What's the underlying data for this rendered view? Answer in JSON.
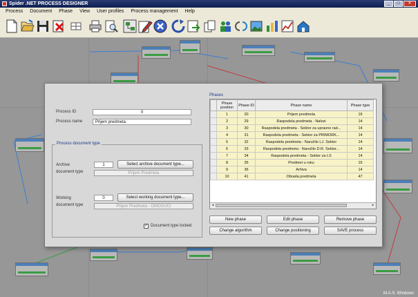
{
  "window": {
    "title": "Spider .NET PROCESS DESIGNER"
  },
  "menu": [
    "Process",
    "Document",
    "Phase",
    "View",
    "User profiles",
    "Process management",
    "Help"
  ],
  "toolbar_icons": [
    "new-icon",
    "open-icon",
    "save-icon",
    "delete-icon",
    "grid-icon",
    "print-icon",
    "print-preview-icon",
    "layout-icon",
    "edit-icon",
    "cancel-icon",
    "refresh-icon",
    "export-icon",
    "copy-icon",
    "users-icon",
    "link-icon",
    "image-icon",
    "chart-icon",
    "graph-icon",
    "home-icon"
  ],
  "status_text": "M.A.S. Windows",
  "dialog": {
    "process_id_label": "Process ID",
    "process_id_value": "0",
    "process_name_label": "Process name",
    "process_name_value": "Prijem predmeta",
    "doc_type_group_title": "Process document type",
    "archive_label": "Archive",
    "archive_label2": "document type",
    "archive_id": "1",
    "archive_button": "Select archive document type...",
    "archive_value": "Prijem Predmeta",
    "working_label": "Working",
    "working_label2": "document type",
    "working_id": "0",
    "working_button": "Select working document type...",
    "working_value": "Prijem Predmeta - OMOGUĆI",
    "locked_checkbox_label": "Document type locked",
    "locked_checked": true,
    "phases_title": "Phases",
    "phases_headers": [
      "Phase position",
      "Phase ID",
      "Phase name",
      "Phase type"
    ],
    "phases_rows": [
      [
        "1",
        "20",
        "Prijem predmeta",
        "16"
      ],
      [
        "2",
        "29",
        "Raspodela predmeta - Nalozi",
        "14"
      ],
      [
        "3",
        "30",
        "Raspodela predmeta - Sektor za upravne rad...",
        "14"
      ],
      [
        "4",
        "31",
        "Raspodela predmeta - Sektor za PRIMORK...",
        "14"
      ],
      [
        "5",
        "32",
        "Raspodela predmeta - Naručilo LJ. Sektor",
        "14"
      ],
      [
        "6",
        "33",
        "Raspodela predmeta - Naručilo D.R. Sektor...",
        "14"
      ],
      [
        "7",
        "34",
        "Raspodela predmeta - Sektor za LS",
        "14"
      ],
      [
        "8",
        "35",
        "Predmet u roku",
        "15"
      ],
      [
        "9",
        "36",
        "Arhiva",
        "14"
      ],
      [
        "10",
        "41",
        "Obrada predmeta",
        "47"
      ]
    ],
    "buttons": {
      "new_phase": "New phase",
      "edit_phase": "Edit phase",
      "remove_phase": "Remove phase",
      "change_algorithm": "Change algorithm",
      "change_positioning": "Change positioning",
      "save_process": "SAVE process"
    }
  }
}
